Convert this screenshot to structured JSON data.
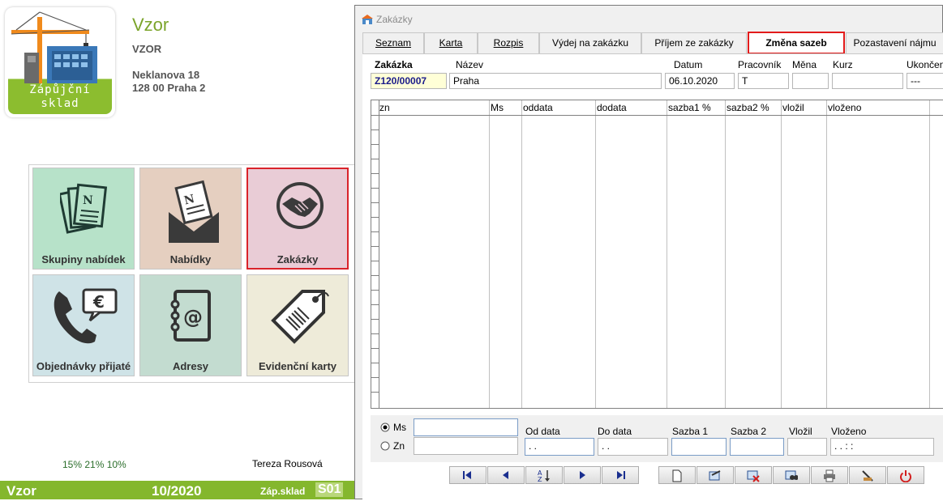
{
  "app": {
    "logo_line1": "Zápůjční",
    "logo_line2": "sklad",
    "company_name": "Vzor",
    "company_code": "VZOR",
    "address_line1": "Neklanova 18",
    "address_line2": "128 00 Praha 2",
    "percentages": "15% 21% 10%",
    "user": "Tereza Rousová",
    "status": {
      "name": "Vzor",
      "period": "10/2020",
      "module": "Záp.sklad",
      "code": "S01"
    },
    "tiles": [
      {
        "label": "Skupiny nabídek",
        "icon": "documents-icon",
        "color": "#b7e2c9"
      },
      {
        "label": "Nabídky",
        "icon": "envelope-icon",
        "color": "#e5cfc0"
      },
      {
        "label": "Zakázky",
        "icon": "handshake-icon",
        "color": "#e9ccd6",
        "selected": true
      },
      {
        "label": "Objednávky přijaté",
        "icon": "phone-euro-icon",
        "color": "#cfe3e7"
      },
      {
        "label": "Adresy",
        "icon": "address-book-icon",
        "color": "#c3dcd0"
      },
      {
        "label": "Evidenční karty",
        "icon": "price-tag-icon",
        "color": "#eeebd9"
      }
    ]
  },
  "window": {
    "title": "Zakázky",
    "tabs": [
      "Seznam",
      "Karta",
      "Rozpis",
      "Výdej na zakázku",
      "Příjem ze zakázky",
      "Změna sazeb",
      "Pozastavení nájmu"
    ],
    "active_tab": "Změna sazeb",
    "header": {
      "labels": {
        "zakazka": "Zakázka",
        "nazev": "Název",
        "datum": "Datum",
        "pracovnik": "Pracovník",
        "mena": "Měna",
        "kurz": "Kurz",
        "ukonceno": "Ukončen"
      },
      "values": {
        "zakazka": "Z120/00007",
        "nazev": "Praha",
        "datum": "06.10.2020",
        "pracovnik": "T",
        "mena": "",
        "kurz": "",
        "ukonceno": "---"
      }
    },
    "grid": {
      "columns": [
        "zn",
        "Ms",
        "oddata",
        "dodata",
        "sazba1 %",
        "sazba2 %",
        "vložil",
        "vloženo"
      ],
      "rows": []
    },
    "filter": {
      "radio_ms": "Ms",
      "radio_zn": "Zn",
      "radio_selected": "Ms",
      "labels": {
        "od_data": "Od data",
        "do_data": "Do data",
        "sazba1": "Sazba 1",
        "sazba2": "Sazba 2",
        "vlozil": "Vložil",
        "vlozeno": "Vloženo"
      },
      "values": {
        "od_data": " . .",
        "do_data": " . .",
        "vlozeno": " . .    : :"
      }
    },
    "toolbar": [
      "first-record-icon",
      "previous-record-icon",
      "sort-icon",
      "next-record-icon",
      "last-record-icon",
      "new-record-icon",
      "edit-record-icon",
      "delete-record-icon",
      "search-icon",
      "print-icon",
      "tools-icon",
      "close-icon"
    ]
  }
}
